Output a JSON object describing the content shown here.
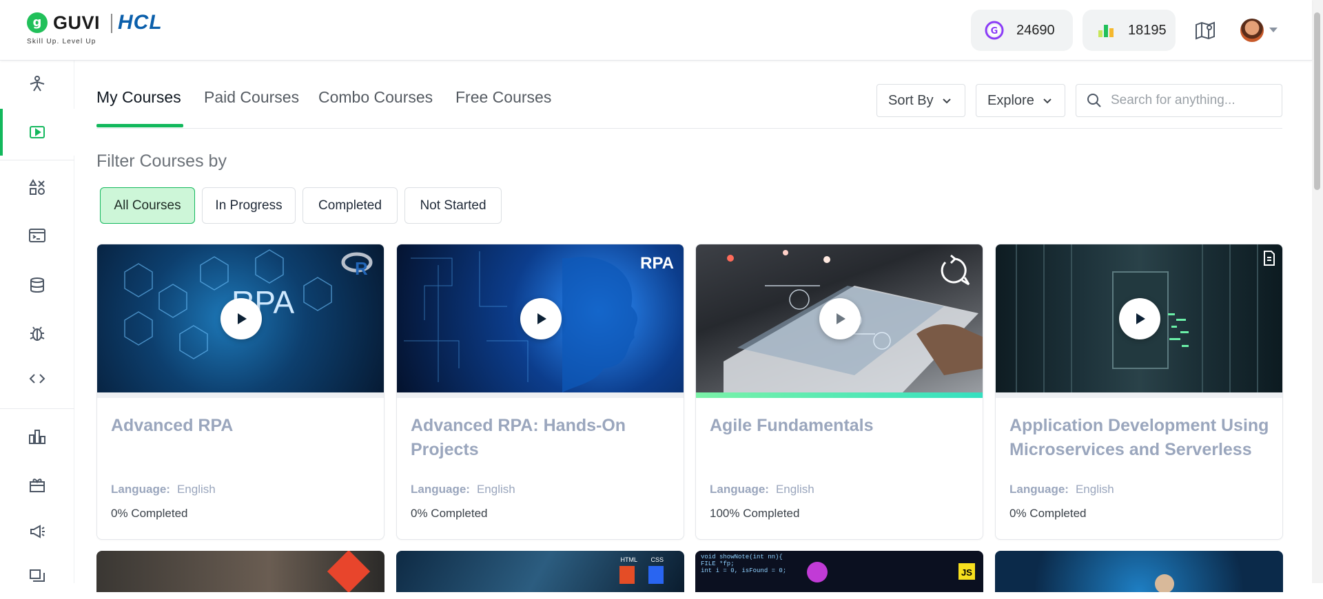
{
  "header": {
    "brand": "GUVI",
    "partner": "HCL",
    "tagline": "Skill Up. Level Up",
    "geekoins": "24690",
    "rank_points": "18195",
    "icons": [
      "geekoins-icon",
      "leaderboard-icon",
      "roadmap-icon",
      "avatar",
      "caret-down-icon"
    ]
  },
  "sidebar": {
    "items": [
      {
        "name": "dashboard-icon"
      },
      {
        "name": "courses-icon",
        "active": true
      },
      {
        "name": "practice-icon"
      },
      {
        "name": "ide-icon"
      },
      {
        "name": "database-icon"
      },
      {
        "name": "debug-icon"
      },
      {
        "name": "code-icon"
      },
      {
        "name": "leaderboard-icon"
      },
      {
        "name": "rewards-icon"
      },
      {
        "name": "announcements-icon"
      },
      {
        "name": "forum-icon"
      }
    ]
  },
  "tabs": [
    {
      "label": "My Courses",
      "active": true
    },
    {
      "label": "Paid Courses"
    },
    {
      "label": "Combo Courses"
    },
    {
      "label": "Free Courses"
    }
  ],
  "controls": {
    "sort_label": "Sort By",
    "explore_label": "Explore",
    "search_placeholder": "Search for anything..."
  },
  "filter": {
    "title": "Filter Courses by",
    "chips": [
      {
        "label": "All Courses",
        "active": true
      },
      {
        "label": "In Progress"
      },
      {
        "label": "Completed"
      },
      {
        "label": "Not Started"
      }
    ]
  },
  "courses": [
    {
      "title": "Advanced RPA",
      "language_label": "Language:",
      "language": "English",
      "progress": "0% Completed",
      "progress_value": 0,
      "thumb_text": "RPA",
      "corner_badge": "R"
    },
    {
      "title": "Advanced RPA: Hands-On Projects",
      "language_label": "Language:",
      "language": "English",
      "progress": "0% Completed",
      "progress_value": 0,
      "corner_badge": "RPA"
    },
    {
      "title": "Agile Fundamentals",
      "language_label": "Language:",
      "language": "English",
      "progress": "100% Completed",
      "progress_value": 100
    },
    {
      "title": "Application Development Using Microservices and Serverless",
      "language_label": "Language:",
      "language": "English",
      "progress": "0% Completed",
      "progress_value": 0
    }
  ],
  "next_row_badges": [
    "HTML",
    "CSS",
    "JS"
  ],
  "colors": {
    "accent": "#12b85c",
    "chip_active_bg": "#cdf6d8",
    "title_muted": "#9aa6bd"
  }
}
